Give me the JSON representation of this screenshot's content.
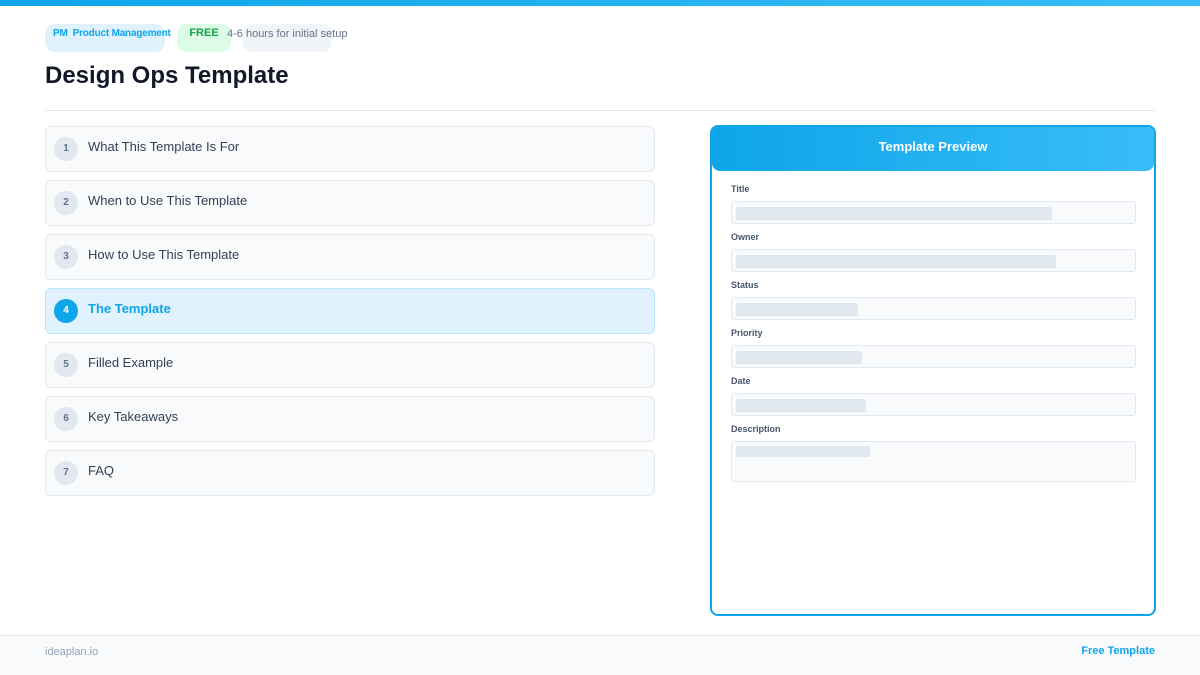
{
  "header": {
    "badges": {
      "pm_short": "PM",
      "pm_label": "Product Management",
      "free": "FREE",
      "time": "4-6 hours for initial setup"
    },
    "title": "Design Ops Template"
  },
  "toc": {
    "active_index": 3,
    "items": [
      {
        "num": "1",
        "label": "What This Template Is For"
      },
      {
        "num": "2",
        "label": "When to Use This Template"
      },
      {
        "num": "3",
        "label": "How to Use This Template"
      },
      {
        "num": "4",
        "label": "The Template"
      },
      {
        "num": "5",
        "label": "Filled Example"
      },
      {
        "num": "6",
        "label": "Key Takeaways"
      },
      {
        "num": "7",
        "label": "FAQ"
      }
    ]
  },
  "preview": {
    "title": "Template Preview",
    "fields": [
      {
        "label": "Title",
        "fill": 0.78
      },
      {
        "label": "Owner",
        "fill": 0.79
      },
      {
        "label": "Status",
        "fill": 0.3
      },
      {
        "label": "Priority",
        "fill": 0.31
      },
      {
        "label": "Date",
        "fill": 0.32
      },
      {
        "label": "Description",
        "fill": 0.33
      }
    ]
  },
  "footer": {
    "site": "ideaplan.io",
    "tag": "Free Template"
  },
  "colors": {
    "accent": "#0ea5e9",
    "accent_light": "#e0f2fe",
    "free_bg": "#dcfce7",
    "free_text": "#16a34a"
  }
}
